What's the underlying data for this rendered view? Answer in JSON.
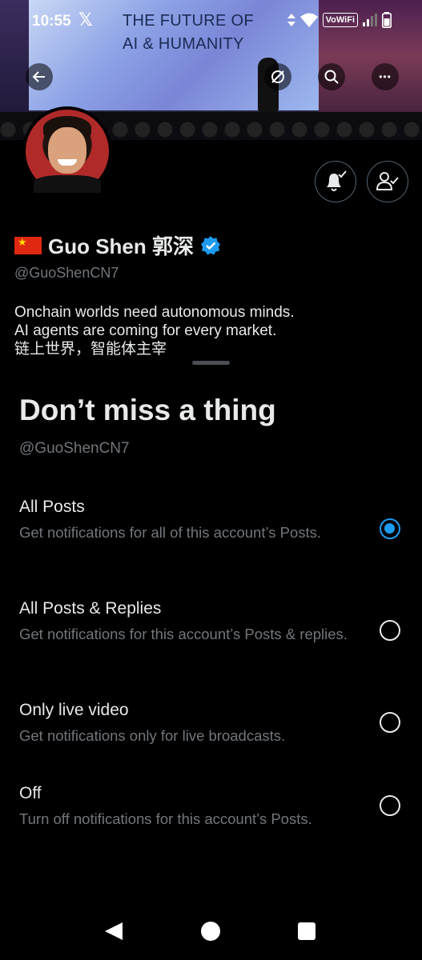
{
  "status_bar": {
    "time": "10:55",
    "x_logo": "𝕏",
    "wifi_calling": "VoWiFi"
  },
  "banner": {
    "headline_line1": "THE FUTURE OF",
    "headline_line2": "AI & HUMANITY"
  },
  "header_buttons": {
    "back_icon": "arrow-left",
    "grok_icon": "grok",
    "search_icon": "search",
    "more_icon": "more-horizontal",
    "more_glyph": "•••"
  },
  "profile": {
    "flag_icon": "china-flag",
    "name": "Guo Shen 郭深",
    "verified_color": "#1d9bf0",
    "handle": "@GuoShenCN7",
    "bio_line1": "Onchain worlds need autonomous minds.",
    "bio_line2": "AI agents are coming for every market.",
    "bio_line3": "链上世界，智能体主宰"
  },
  "sheet": {
    "title": "Don’t miss a thing",
    "handle": "@GuoShenCN7",
    "options": [
      {
        "title": "All Posts",
        "desc": "Get notifications for all of this account’s Posts.",
        "selected": true
      },
      {
        "title": "All Posts & Replies",
        "desc": "Get notifications for this account’s Posts & replies.",
        "selected": false
      },
      {
        "title": "Only live video",
        "desc": "Get notifications only for live broadcasts.",
        "selected": false
      },
      {
        "title": "Off",
        "desc": "Turn off notifications for this account’s Posts.",
        "selected": false
      }
    ]
  },
  "colors": {
    "accent": "#1d9bf0",
    "secondary_text": "#71767b",
    "background": "#000000"
  }
}
